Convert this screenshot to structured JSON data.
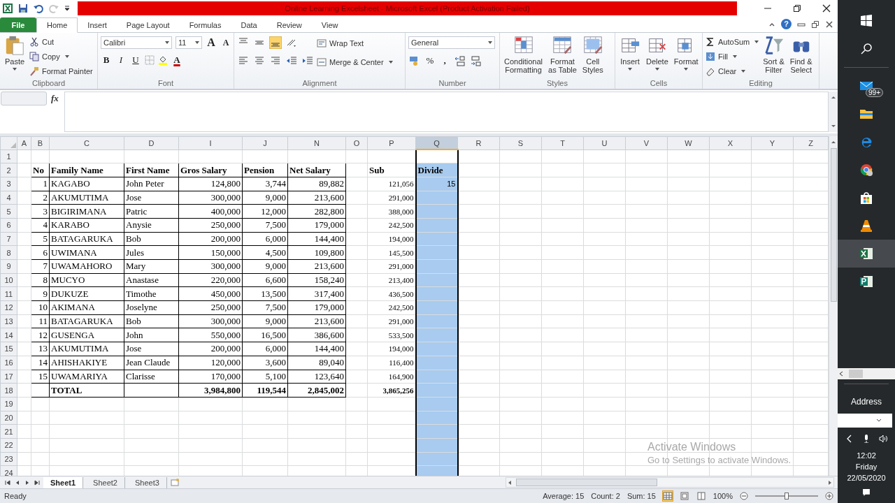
{
  "quick_access": {
    "redo_disabled": true
  },
  "window": {
    "title": "Online Learning Excelsheet  -  Microsoft Excel (Product Activation Failed)"
  },
  "tabs": [
    {
      "label": "File",
      "kind": "file",
      "selected": false
    },
    {
      "label": "Home",
      "kind": "tab",
      "selected": true
    },
    {
      "label": "Insert",
      "kind": "tab",
      "selected": false
    },
    {
      "label": "Page Layout",
      "kind": "tab",
      "selected": false
    },
    {
      "label": "Formulas",
      "kind": "tab",
      "selected": false
    },
    {
      "label": "Data",
      "kind": "tab",
      "selected": false
    },
    {
      "label": "Review",
      "kind": "tab",
      "selected": false
    },
    {
      "label": "View",
      "kind": "tab",
      "selected": false
    }
  ],
  "help_button": "?",
  "ribbon": {
    "clipboard": {
      "label": "Clipboard",
      "paste": "Paste",
      "cut": "Cut",
      "copy": "Copy",
      "format_painter": "Format Painter"
    },
    "font": {
      "label": "Font",
      "font_name": "Calibri",
      "font_size": "11",
      "grow": "A",
      "shrink": "A",
      "bold": "B",
      "italic": "I",
      "underline": "U",
      "font_color": "A"
    },
    "alignment": {
      "label": "Alignment",
      "wrap_text": "Wrap Text",
      "merge_center": "Merge & Center",
      "bottom_align_on": true
    },
    "number": {
      "label": "Number",
      "format": "General",
      "percent": "%",
      "comma": ","
    },
    "styles": {
      "label": "Styles",
      "buttons": [
        [
          "Conditional",
          "Formatting"
        ],
        [
          "Format",
          "as Table"
        ],
        [
          "Cell",
          "Styles"
        ]
      ]
    },
    "cells": {
      "label": "Cells",
      "buttons": [
        "Insert",
        "Delete",
        "Format"
      ]
    },
    "editing": {
      "label": "Editing",
      "autosum": "AutoSum",
      "fill": "Fill",
      "clear": "Clear",
      "sort_filter": [
        "Sort &",
        "Filter"
      ],
      "find_select": [
        "Find &",
        "Select"
      ]
    }
  },
  "formula_bar": {
    "fx": "fx"
  },
  "sheet": {
    "columns": [
      {
        "label": "A",
        "selected": false
      },
      {
        "label": "B",
        "selected": false
      },
      {
        "label": "C",
        "selected": false
      },
      {
        "label": "D",
        "selected": false
      },
      {
        "label": "I",
        "selected": false
      },
      {
        "label": "J",
        "selected": false
      },
      {
        "label": "N",
        "selected": false
      },
      {
        "label": "O",
        "selected": false
      },
      {
        "label": "P",
        "selected": false
      },
      {
        "label": "Q",
        "selected": true
      },
      {
        "label": "R",
        "selected": false
      },
      {
        "label": "S",
        "selected": false
      },
      {
        "label": "T",
        "selected": false
      },
      {
        "label": "U",
        "selected": false
      },
      {
        "label": "V",
        "selected": false
      },
      {
        "label": "W",
        "selected": false
      },
      {
        "label": "X",
        "selected": false
      },
      {
        "label": "Y",
        "selected": false
      },
      {
        "label": "Z",
        "selected": false
      }
    ],
    "rows": [
      {
        "number": "1"
      },
      {
        "number": "2",
        "kind": "header",
        "cells": {
          "no": "No",
          "family_name": "Family Name",
          "first_name": "First Name",
          "gros_salary": "Gros Salary",
          "pension": "Pension",
          "net_salary": "Net Salary",
          "sub": "Sub",
          "divide": "Divide"
        }
      },
      {
        "number": "3",
        "kind": "data",
        "cells": {
          "no": "1",
          "family_name": "KAGABO",
          "first_name": "John Peter",
          "gros_salary": "124,800",
          "pension": "3,744",
          "net_salary": "89,882",
          "sub": "121,056",
          "divide": "15"
        }
      },
      {
        "number": "4",
        "kind": "data",
        "cells": {
          "no": "2",
          "family_name": "AKUMUTIMA",
          "first_name": "Jose",
          "gros_salary": "300,000",
          "pension": "9,000",
          "net_salary": "213,600",
          "sub": "291,000"
        }
      },
      {
        "number": "5",
        "kind": "data",
        "cells": {
          "no": "3",
          "family_name": "BIGIRIMANA",
          "first_name": "Patric",
          "gros_salary": "400,000",
          "pension": "12,000",
          "net_salary": "282,800",
          "sub": "388,000"
        }
      },
      {
        "number": "6",
        "kind": "data",
        "cells": {
          "no": "4",
          "family_name": "KARABO",
          "first_name": "Anysie",
          "gros_salary": "250,000",
          "pension": "7,500",
          "net_salary": "179,000",
          "sub": "242,500"
        }
      },
      {
        "number": "7",
        "kind": "data",
        "cells": {
          "no": "5",
          "family_name": "BATAGARUKA",
          "first_name": "Bob",
          "gros_salary": "200,000",
          "pension": "6,000",
          "net_salary": "144,400",
          "sub": "194,000"
        }
      },
      {
        "number": "8",
        "kind": "data",
        "cells": {
          "no": "6",
          "family_name": "UWIMANA",
          "first_name": "Jules",
          "gros_salary": "150,000",
          "pension": "4,500",
          "net_salary": "109,800",
          "sub": "145,500"
        }
      },
      {
        "number": "9",
        "kind": "data",
        "cells": {
          "no": "7",
          "family_name": "UWAMAHORO",
          "first_name": "Mary",
          "gros_salary": "300,000",
          "pension": "9,000",
          "net_salary": "213,600",
          "sub": "291,000"
        }
      },
      {
        "number": "10",
        "kind": "data",
        "cells": {
          "no": "8",
          "family_name": "MUCYO",
          "first_name": "Anastase",
          "gros_salary": "220,000",
          "pension": "6,600",
          "net_salary": "158,240",
          "sub": "213,400"
        }
      },
      {
        "number": "11",
        "kind": "data",
        "cells": {
          "no": "9",
          "family_name": "DUKUZE",
          "first_name": "Timothe",
          "gros_salary": "450,000",
          "pension": "13,500",
          "net_salary": "317,400",
          "sub": "436,500"
        }
      },
      {
        "number": "12",
        "kind": "data",
        "cells": {
          "no": "10",
          "family_name": "AKIMANA",
          "first_name": "Joselyne",
          "gros_salary": "250,000",
          "pension": "7,500",
          "net_salary": "179,000",
          "sub": "242,500"
        }
      },
      {
        "number": "13",
        "kind": "data",
        "cells": {
          "no": "11",
          "family_name": "BATAGARUKA",
          "first_name": "Bob",
          "gros_salary": "300,000",
          "pension": "9,000",
          "net_salary": "213,600",
          "sub": "291,000"
        }
      },
      {
        "number": "14",
        "kind": "data",
        "cells": {
          "no": "12",
          "family_name": "GUSENGA",
          "first_name": "John",
          "gros_salary": "550,000",
          "pension": "16,500",
          "net_salary": "386,600",
          "sub": "533,500"
        }
      },
      {
        "number": "15",
        "kind": "data",
        "cells": {
          "no": "13",
          "family_name": "AKUMUTIMA",
          "first_name": "Jose",
          "gros_salary": "200,000",
          "pension": "6,000",
          "net_salary": "144,400",
          "sub": "194,000"
        }
      },
      {
        "number": "16",
        "kind": "data",
        "cells": {
          "no": "14",
          "family_name": "AHISHAKIYE",
          "first_name": "Jean Claude",
          "gros_salary": "120,000",
          "pension": "3,600",
          "net_salary": "89,040",
          "sub": "116,400"
        }
      },
      {
        "number": "17",
        "kind": "data",
        "cells": {
          "no": "15",
          "family_name": "UWAMARIYA",
          "first_name": "Clarisse",
          "gros_salary": "170,000",
          "pension": "5,100",
          "net_salary": "123,640",
          "sub": "164,900"
        }
      },
      {
        "number": "18",
        "kind": "total",
        "cells": {
          "family_name": "TOTAL",
          "gros_salary": "3,984,800",
          "pension": "119,544",
          "net_salary": "2,845,002",
          "sub": "3,865,256"
        }
      },
      {
        "number": "19"
      },
      {
        "number": "20"
      },
      {
        "number": "21"
      },
      {
        "number": "22"
      },
      {
        "number": "23"
      },
      {
        "number": "24"
      }
    ]
  },
  "sheet_tabs": [
    {
      "label": "Sheet1",
      "selected": true
    },
    {
      "label": "Sheet2",
      "selected": false
    },
    {
      "label": "Sheet3",
      "selected": false
    }
  ],
  "activation_notice": {
    "title": "Activate Windows",
    "hint": "Go to Settings to activate Windows."
  },
  "status_bar": {
    "mode": "Ready",
    "average": "Average: 15",
    "count": "Count: 2",
    "sum": "Sum: 15",
    "zoom": "100%",
    "zoom_level": {
      "level": 0.5
    }
  },
  "taskbar": {
    "mail_badge": "99+",
    "address_label": "Address",
    "time": "12:02",
    "day": "Friday",
    "date": "22/05/2020"
  }
}
